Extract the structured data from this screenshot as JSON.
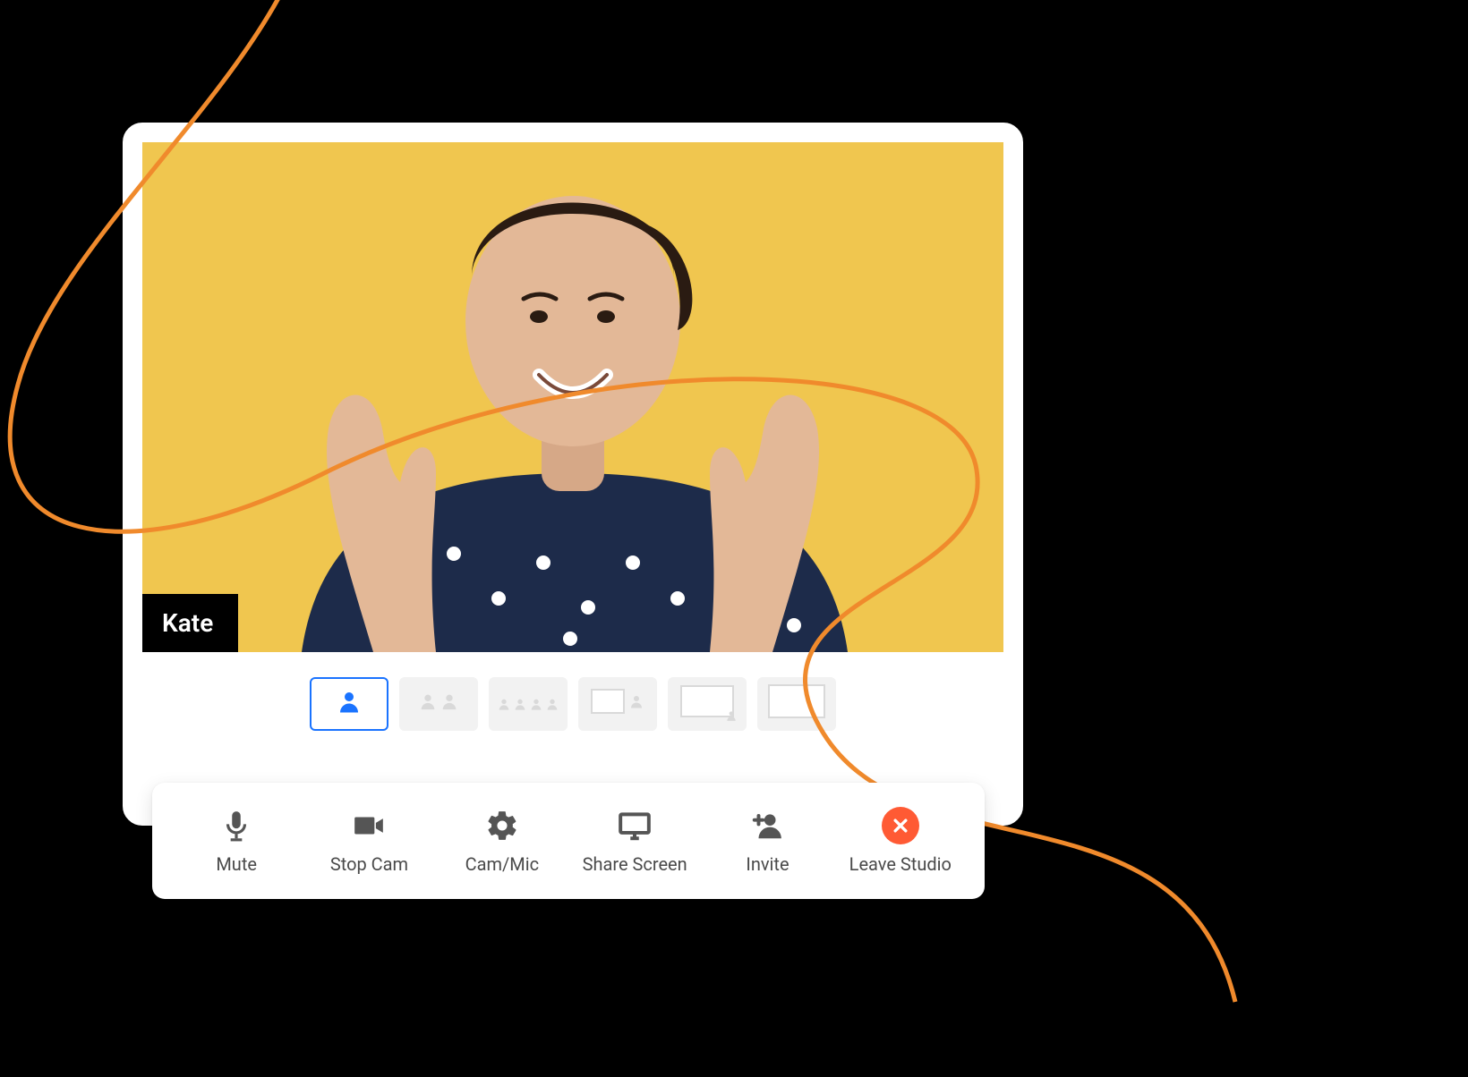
{
  "participant": {
    "name": "Kate"
  },
  "controls": {
    "mute": "Mute",
    "stop": "Stop Cam",
    "cammic": "Cam/Mic",
    "share": "Share Screen",
    "invite": "Invite",
    "leave": "Leave Studio"
  },
  "colors": {
    "accent": "#1a73ff",
    "danger": "#ff5a34",
    "videoBg": "#f0c64f"
  }
}
